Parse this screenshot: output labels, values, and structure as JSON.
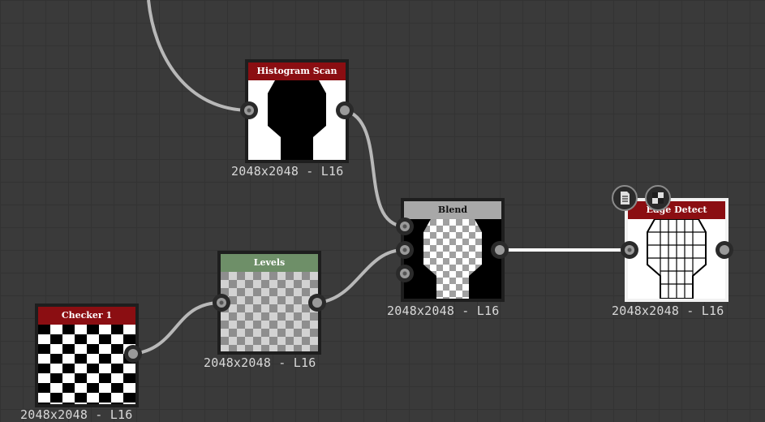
{
  "colors": {
    "canvas": "#3a3a3a",
    "wire": "#b8b8b8",
    "wire_active": "#ffffff",
    "title_red": "#8b0e12",
    "title_green": "#6e8f68",
    "title_gray": "#a8a8a8"
  },
  "nodes": {
    "histogram_scan": {
      "title": "Histogram Scan",
      "resolution": "2048x2048 - L16"
    },
    "blend": {
      "title": "Blend",
      "resolution": "2048x2048 - L16"
    },
    "edge_detect": {
      "title": "Edge Detect",
      "resolution": "2048x2048 - L16",
      "badges": [
        "document-icon",
        "checker-icon"
      ]
    },
    "levels": {
      "title": "Levels",
      "resolution": "2048x2048 - L16"
    },
    "checker": {
      "title": "Checker 1",
      "resolution": "2048x2048 - L16"
    }
  }
}
